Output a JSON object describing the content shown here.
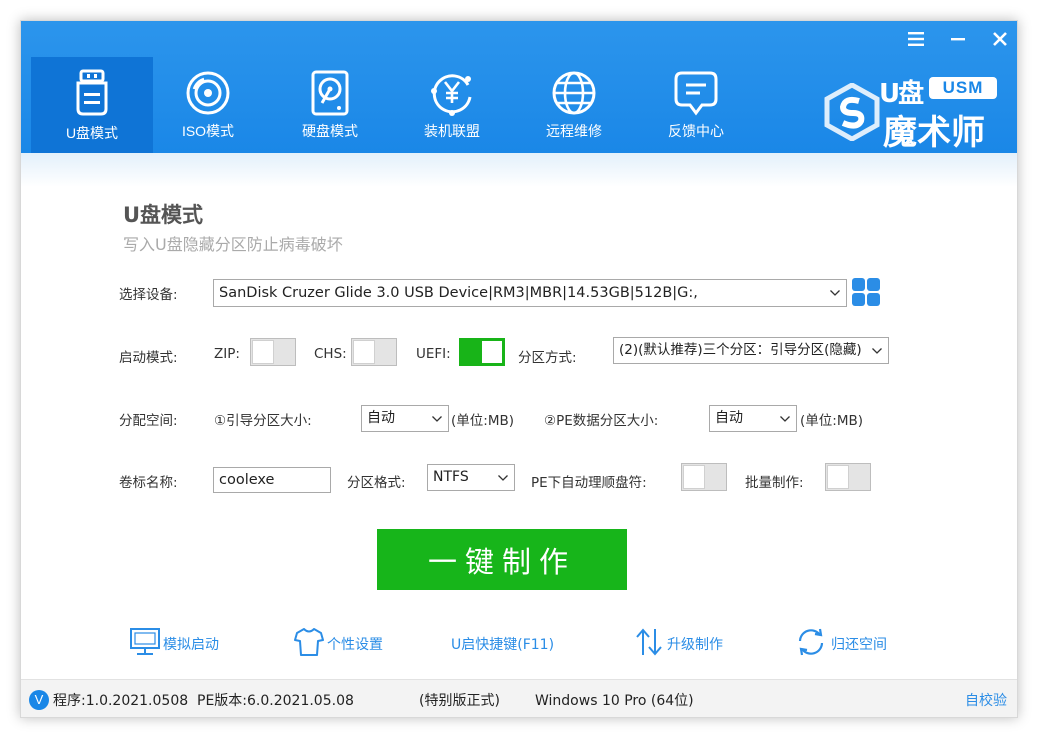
{
  "window_controls": {
    "menu_icon": "menu-icon",
    "minimize_icon": "minimize-icon",
    "close_icon": "close-icon"
  },
  "nav": [
    {
      "label": "U盘模式",
      "icon": "usb-drive-icon",
      "active": true
    },
    {
      "label": "ISO模式",
      "icon": "disc-icon",
      "active": false
    },
    {
      "label": "硬盘模式",
      "icon": "hard-drive-icon",
      "active": false
    },
    {
      "label": "装机联盟",
      "icon": "yen-alliance-icon",
      "active": false
    },
    {
      "label": "远程维修",
      "icon": "globe-icon",
      "active": false
    },
    {
      "label": "反馈中心",
      "icon": "chat-bubble-icon",
      "active": false
    }
  ],
  "logo": {
    "top": "U盘",
    "badge": "USM",
    "name": "魔术师"
  },
  "content": {
    "title": "U盘模式",
    "subtitle": "写入U盘隐藏分区防止病毒破坏",
    "device_label": "选择设备:",
    "device_value": "SanDisk Cruzer Glide 3.0 USB Device|RM3|MBR|14.53GB|512B|G:,",
    "boot_label": "启动模式:",
    "zip_label": "ZIP:",
    "chs_label": "CHS:",
    "uefi_label": "UEFI:",
    "zip_on": false,
    "chs_on": false,
    "uefi_on": true,
    "partition_mode_label": "分区方式:",
    "partition_mode_value": "(2)(默认推荐)三个分区：引导分区(隐藏)",
    "alloc_label": "分配空间:",
    "boot_size_label": "①引导分区大小:",
    "boot_size_value": "自动",
    "boot_size_unit": "(单位:MB)",
    "pe_size_label": "②PE数据分区大小:",
    "pe_size_value": "自动",
    "pe_size_unit": "(单位:MB)",
    "volume_label": "卷标名称:",
    "volume_value": "coolexe",
    "fs_label": "分区格式:",
    "fs_value": "NTFS",
    "pe_auto_label": "PE下自动理顺盘符:",
    "pe_auto_on": false,
    "batch_label": "批量制作:",
    "batch_on": false,
    "make_button": "一键制作"
  },
  "tools": [
    {
      "label": "模拟启动",
      "icon": "monitor-icon"
    },
    {
      "label": "个性设置",
      "icon": "tshirt-icon"
    },
    {
      "label": "U启快捷键(F11)",
      "icon": ""
    },
    {
      "label": "升级制作",
      "icon": "upgrade-arrows-icon"
    },
    {
      "label": "归还空间",
      "icon": "refresh-icon"
    }
  ],
  "status": {
    "badge": "V",
    "program_version": "程序:1.0.2021.0508",
    "pe_version": "PE版本:6.0.2021.05.08",
    "edition": "(特别版正式)",
    "os": "Windows 10 Pro (64位)",
    "verify": "自校验"
  },
  "colors": {
    "header": "#1a87e7",
    "active_tab": "#0f74d6",
    "green": "#17b51a",
    "link": "#2b8de6"
  }
}
